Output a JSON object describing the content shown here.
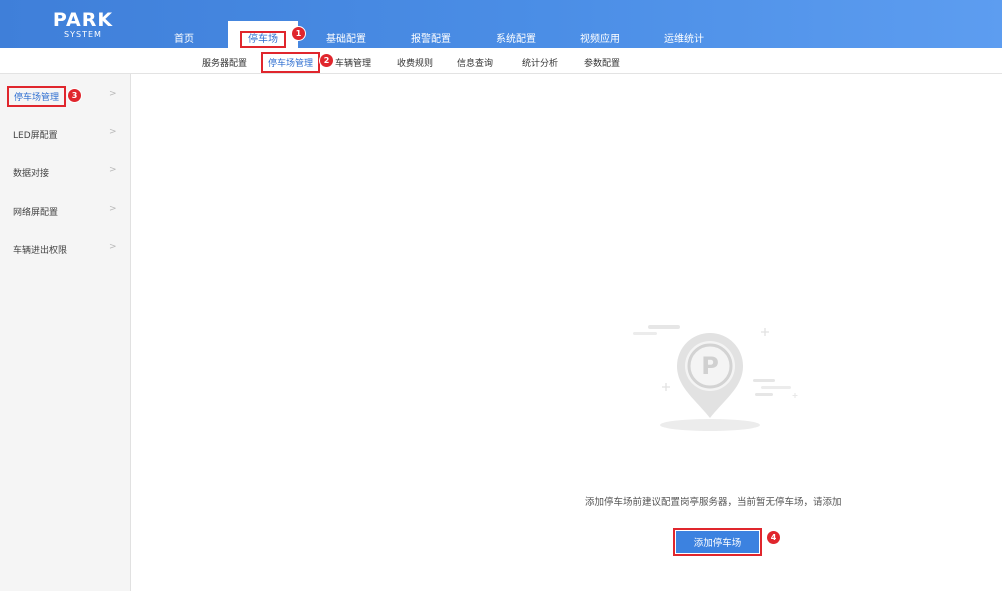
{
  "brand": {
    "line1": "PARK",
    "line2": "SYSTEM"
  },
  "top_nav": {
    "home": "首页",
    "parking": "停车场",
    "basic_config": "基础配置",
    "alarm_config": "报警配置",
    "system_config": "系统配置",
    "video_app": "视频应用",
    "ops_stats": "运维统计"
  },
  "sub_nav": {
    "server_config": "服务器配置",
    "parking_mgmt": "停车场管理",
    "vehicle_mgmt": "车辆管理",
    "fee_rules": "收费规则",
    "info_query": "信息查询",
    "stats_analysis": "统计分析",
    "param_config": "参数配置"
  },
  "sidebar": {
    "items": [
      {
        "label": "停车场管理",
        "chevron": ">"
      },
      {
        "label": "LED屏配置",
        "chevron": ">"
      },
      {
        "label": "数据对接",
        "chevron": ">"
      },
      {
        "label": "网络屏配置",
        "chevron": ">"
      },
      {
        "label": "车辆进出权限",
        "chevron": ">"
      }
    ]
  },
  "markers": {
    "m1": "1",
    "m2": "2",
    "m3": "3",
    "m4": "4"
  },
  "empty_state": {
    "icon": "parking-location-pin-icon",
    "icon_letter": "P",
    "message": "添加停车场前建议配置岗亭服务器，当前暂无停车场，请添加",
    "add_button": "添加停车场"
  },
  "colors": {
    "header_blue": "#4b8ee6",
    "primary_blue": "#3c82e0",
    "annotation_red": "#e0262d",
    "sidebar_bg": "#f5f5f5"
  }
}
